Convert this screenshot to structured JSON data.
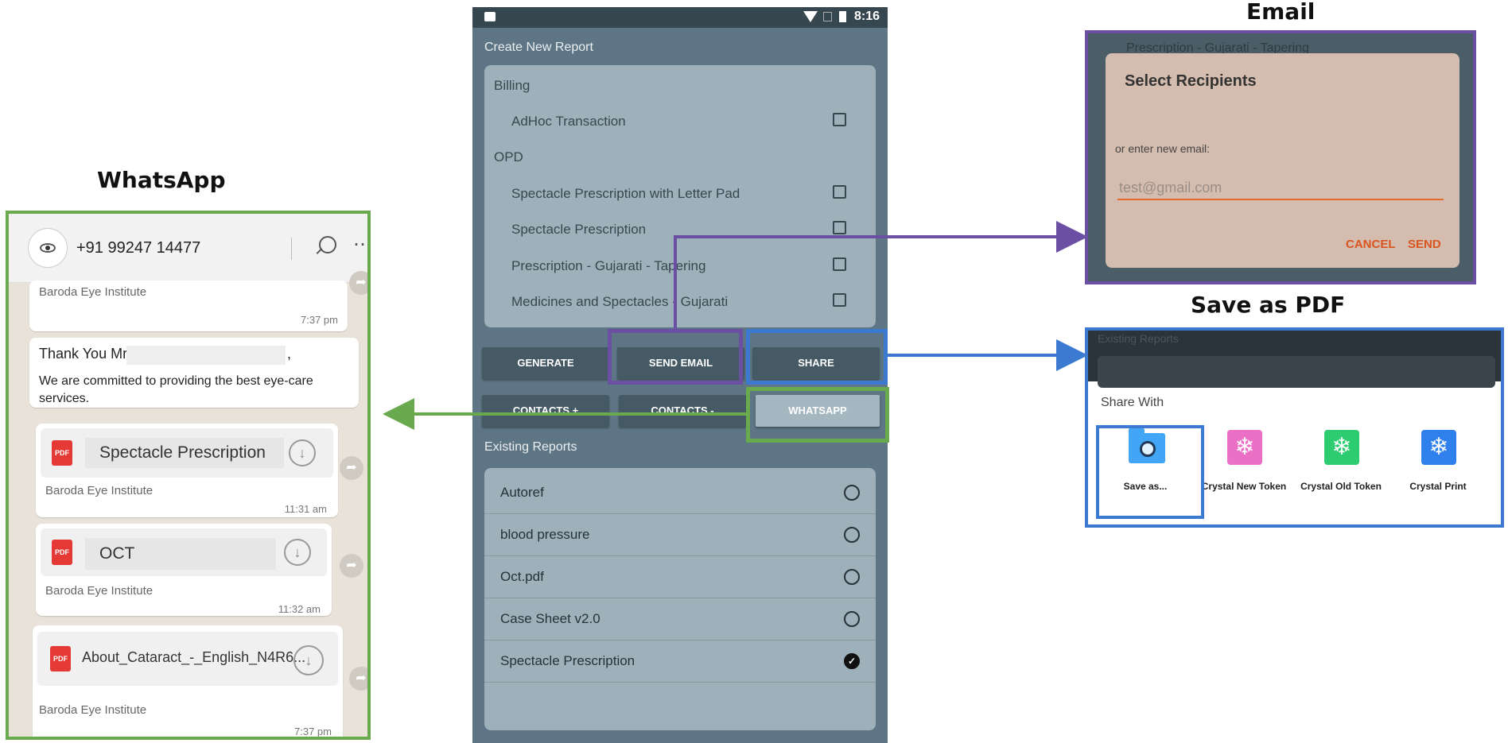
{
  "headings": {
    "whatsapp": "WhatsApp",
    "email": "Email",
    "save_pdf": "Save as PDF"
  },
  "colors": {
    "whatsapp_border": "#6aaa4f",
    "email_border": "#6a4fa3",
    "pdf_border": "#3c7ad1",
    "accent_orange": "#d9541e"
  },
  "whatsapp": {
    "phone": "+91 99247 14477",
    "messages": [
      {
        "org": "Baroda Eye Institute",
        "time": "7:37 pm"
      },
      {
        "thanks": "Thank You Mr.",
        "comma": ",",
        "body": "We are committed to providing the best eye-care services."
      },
      {
        "file": "Spectacle Prescription",
        "org": "Baroda Eye Institute",
        "time": "11:31 am"
      },
      {
        "file": "OCT",
        "org": "Baroda Eye Institute",
        "time": "11:32 am"
      },
      {
        "file": "About_Cataract_-_English_N4R6...",
        "org": "Baroda Eye Institute",
        "time": "7:37 pm"
      }
    ],
    "pdf_label": "PDF"
  },
  "phone": {
    "status_time": "8:16",
    "create_title": "Create New Report",
    "groups": [
      {
        "name": "Billing",
        "items": [
          "AdHoc Transaction"
        ]
      },
      {
        "name": "OPD",
        "items": [
          "Spectacle Prescription with Letter Pad",
          "Spectacle Prescription",
          "Prescription - Gujarati - Tapering",
          "Medicines and Spectacles - Gujarati"
        ]
      }
    ],
    "buttons": {
      "generate": "GENERATE",
      "send_email": "SEND EMAIL",
      "share": "SHARE",
      "contacts_plus": "CONTACTS +",
      "contacts_minus": "CONTACTS -",
      "whatsapp": "WHATSAPP"
    },
    "existing_title": "Existing Reports",
    "reports": [
      {
        "name": "Autoref",
        "selected": false
      },
      {
        "name": "blood pressure",
        "selected": false
      },
      {
        "name": "Oct.pdf",
        "selected": false
      },
      {
        "name": "Case Sheet v2.0",
        "selected": false
      },
      {
        "name": "Spectacle Prescription",
        "selected": true
      }
    ]
  },
  "email_dialog": {
    "bg_text": "Prescription - Gujarati - Tapering",
    "title": "Select Recipients",
    "label": "or enter new email:",
    "placeholder": "test@gmail.com",
    "cancel": "CANCEL",
    "send": "SEND"
  },
  "share_sheet": {
    "bg_text": "Existing Reports",
    "title": "Share With",
    "apps": [
      {
        "name": "Save as...",
        "icon": "folder-search-icon"
      },
      {
        "name": "Crystal New Token",
        "icon": "snowflake-icon",
        "color": "#ec6fc6"
      },
      {
        "name": "Crystal Old Token",
        "icon": "snowflake-icon",
        "color": "#2ecc71"
      },
      {
        "name": "Crystal Print",
        "icon": "snowflake-icon",
        "color": "#2f80ed"
      }
    ]
  }
}
